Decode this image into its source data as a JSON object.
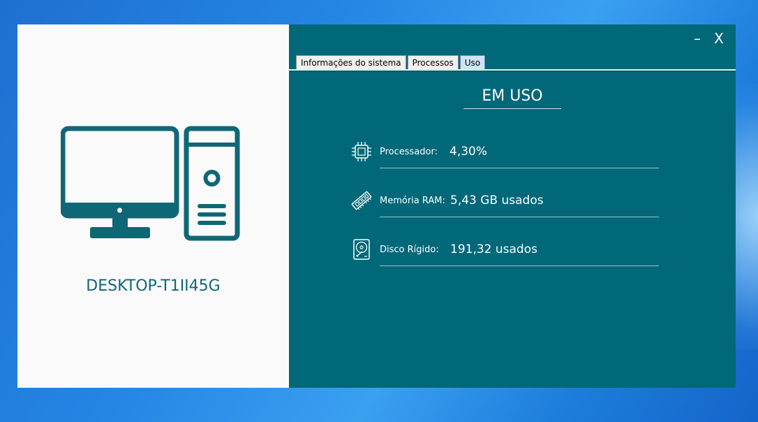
{
  "window": {
    "minimize_label": "–",
    "close_label": "X"
  },
  "left": {
    "computer_icon": "desktop-computer-icon",
    "hostname": "DESKTOP-T1II45G"
  },
  "tabs": [
    {
      "label": "Informações do sistema",
      "active": false
    },
    {
      "label": "Processos",
      "active": false
    },
    {
      "label": "Uso",
      "active": true
    }
  ],
  "usage": {
    "title": "EM USO",
    "processor": {
      "label": "Processador:",
      "value": "4,30%",
      "icon": "cpu-chip-icon"
    },
    "memory": {
      "label": "Memória RAM:",
      "value": "5,43 GB usados",
      "icon": "ram-stick-icon"
    },
    "disk": {
      "label": "Disco Rígido:",
      "value": "191,32 usados",
      "icon": "hard-disk-icon"
    }
  },
  "colors": {
    "accent": "#006879",
    "left_panel": "#fafafa",
    "icon_color": "#0f6776"
  }
}
